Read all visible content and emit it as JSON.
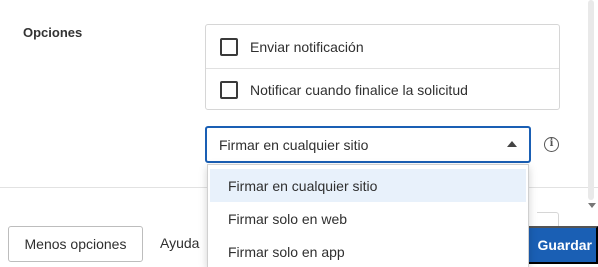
{
  "section": {
    "label": "Opciones"
  },
  "options": [
    {
      "label": "Enviar notificación",
      "checked": false
    },
    {
      "label": "Notificar cuando finalice la solicitud",
      "checked": false
    }
  ],
  "sign_select": {
    "value": "Firmar en cualquier sitio",
    "options": [
      "Firmar en cualquier sitio",
      "Firmar solo en web",
      "Firmar solo en app"
    ],
    "info_icon": "info-icon"
  },
  "footer": {
    "less_options": "Menos opciones",
    "help": "Ayuda",
    "save": "Guardar"
  },
  "colors": {
    "accent": "#1a5fb4",
    "selected_row": "#e8f1fb"
  }
}
